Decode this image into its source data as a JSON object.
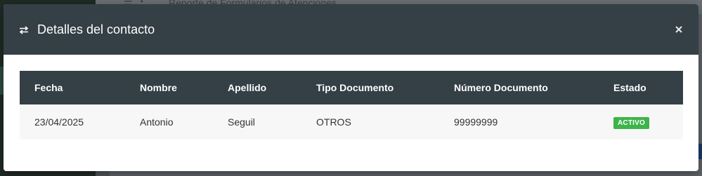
{
  "background": {
    "page_title": "Reporte de Formularios de Atenciones"
  },
  "modal": {
    "title": "Detalles del contacto",
    "header_icon": "swap-arrows-icon",
    "close_icon": "close-icon",
    "table": {
      "headers": [
        "Fecha",
        "Nombre",
        "Apellido",
        "Tipo Documento",
        "Número Documento",
        "Estado"
      ],
      "rows": [
        {
          "fecha": "23/04/2025",
          "nombre": "Antonio",
          "apellido": "Seguil",
          "tipo_documento": "OTROS",
          "numero_documento": "99999999",
          "estado": "ACTIVO"
        }
      ]
    }
  },
  "colors": {
    "header_bg": "#343f46",
    "badge_active": "#3db44b",
    "row_bg": "#f7f7f7"
  }
}
